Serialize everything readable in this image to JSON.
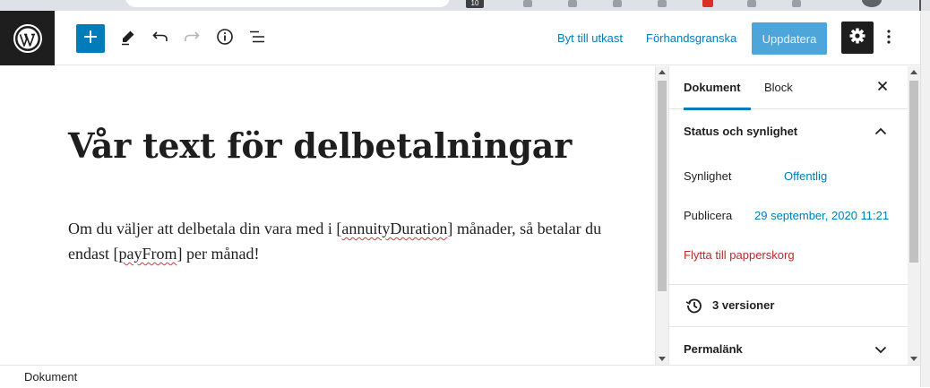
{
  "browser": {
    "badge_count": "10"
  },
  "toolbar": {
    "switch_to_draft": "Byt till utkast",
    "preview": "Förhandsgranska",
    "update": "Uppdatera",
    "icons": [
      "wordpress-icon",
      "plus-icon",
      "pencil-icon",
      "undo-icon",
      "redo-icon",
      "info-icon",
      "list-view-icon",
      "gear-icon",
      "more-vertical-icon"
    ]
  },
  "post": {
    "title": "Vår text för delbetalningar",
    "paragraph": {
      "p1": "Om du väljer att delbetala din vara med i [",
      "w1": "annuityDuration",
      "p2": "] månader, så betalar du endast [",
      "w2": "payFrom",
      "p3": "] per månad!"
    }
  },
  "sidebar": {
    "tabs": {
      "document": "Dokument",
      "block": "Block"
    },
    "status_panel": {
      "title": "Status och synlighet",
      "visibility_label": "Synlighet",
      "visibility_value": "Offentlig",
      "publish_label": "Publicera",
      "publish_value": "29 september, 2020 11:21",
      "trash": "Flytta till papperskorg"
    },
    "revisions": "3 versioner",
    "permalink_panel": {
      "title": "Permalänk"
    }
  },
  "footer": {
    "breadcrumb": "Dokument"
  },
  "colors": {
    "accent": "#007cba",
    "dark": "#1e1e1e",
    "danger": "#b32d2e"
  }
}
